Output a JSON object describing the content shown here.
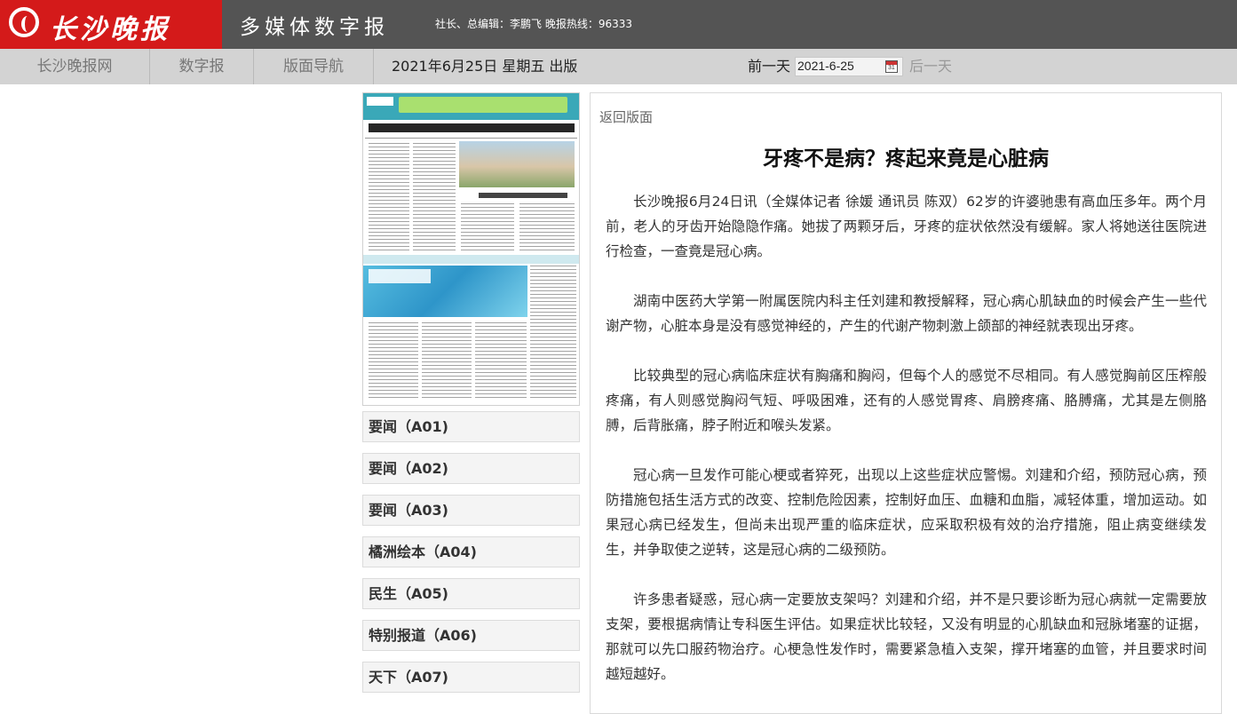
{
  "header": {
    "logo_text": "长沙晚报",
    "site_title": "多媒体数字报",
    "editor_info": "社长、总编辑：李鹏飞 晚报热线：96333"
  },
  "nav": {
    "items": [
      "长沙晚报网",
      "数字报",
      "版面导航"
    ],
    "date_text": "2021年6月25日 星期五 出版",
    "prev_label": "前一天",
    "date_value": "2021-6-25",
    "calendar_day": "31",
    "next_label": "后一天"
  },
  "icons": {
    "calendar": "calendar-icon",
    "logo": "logo-icon"
  },
  "sections": [
    "要闻（A01)",
    "要闻（A02)",
    "要闻（A03)",
    "橘洲绘本（A04)",
    "民生（A05)",
    "特别报道（A06)",
    "天下（A07)"
  ],
  "article": {
    "back_label": "返回版面",
    "title": "牙疼不是病？疼起来竟是心脏病",
    "paragraphs": [
      "长沙晚报6月24日讯（全媒体记者 徐媛 通讯员 陈双）62岁的许婆驰患有高血压多年。两个月前，老人的牙齿开始隐隐作痛。她拔了两颗牙后，牙疼的症状依然没有缓解。家人将她送往医院进行检查，一查竟是冠心病。",
      "湖南中医药大学第一附属医院内科主任刘建和教授解释，冠心病心肌缺血的时候会产生一些代谢产物，心脏本身是没有感觉神经的，产生的代谢产物刺激上颌部的神经就表现出牙疼。",
      "比较典型的冠心病临床症状有胸痛和胸闷，但每个人的感觉不尽相同。有人感觉胸前区压榨般疼痛，有人则感觉胸闷气短、呼吸困难，还有的人感觉胃疼、肩膀疼痛、胳膊痛，尤其是左侧胳膊，后背胀痛，脖子附近和喉头发紧。",
      "冠心病一旦发作可能心梗或者猝死，出现以上这些症状应警惕。刘建和介绍，预防冠心病，预防措施包括生活方式的改变、控制危险因素，控制好血压、血糖和血脂，减轻体重，增加运动。如果冠心病已经发生，但尚未出现严重的临床症状，应采取积极有效的治疗措施，阻止病变继续发生，并争取使之逆转，这是冠心病的二级预防。",
      "许多患者疑惑，冠心病一定要放支架吗？刘建和介绍，并不是只要诊断为冠心病就一定需要放支架，要根据病情让专科医生评估。如果症状比较轻，又没有明显的心肌缺血和冠脉堵塞的证据，那就可以先口服药物治疗。心梗急性发作时，需要紧急植入支架，撑开堵塞的血管，并且要求时间越短越好。"
    ]
  }
}
